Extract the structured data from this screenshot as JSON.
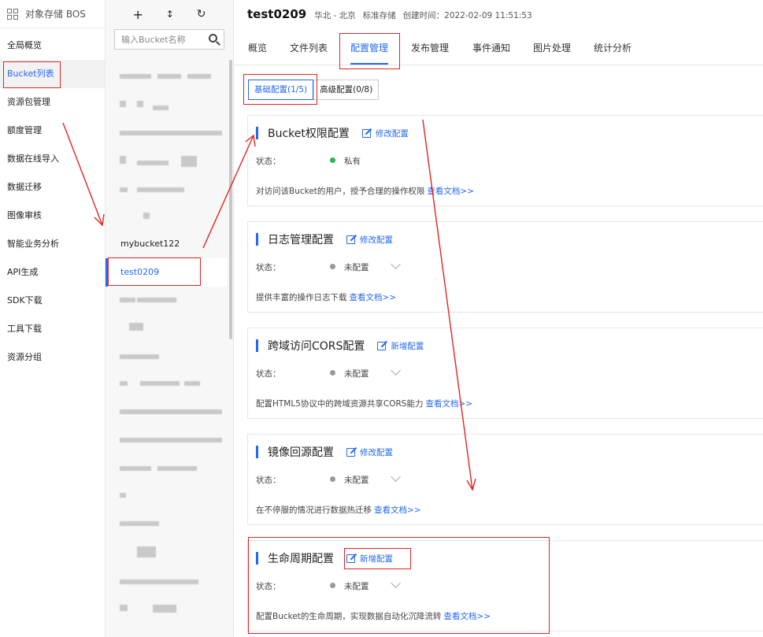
{
  "app": {
    "title": "对象存储 BOS"
  },
  "nav": {
    "items": [
      {
        "label": "全局概览"
      },
      {
        "label": "Bucket列表",
        "active": true
      },
      {
        "label": "资源包管理"
      },
      {
        "label": "额度管理"
      },
      {
        "label": "数据在线导入"
      },
      {
        "label": "数据迁移"
      },
      {
        "label": "图像审核"
      },
      {
        "label": "智能业务分析"
      },
      {
        "label": "API生成"
      },
      {
        "label": "SDK下载"
      },
      {
        "label": "工具下载"
      },
      {
        "label": "资源分组"
      }
    ]
  },
  "bucket_panel": {
    "tools": {
      "add": "+",
      "sort": "↕",
      "refresh": "↻"
    },
    "search": {
      "placeholder": "输入Bucket名称"
    },
    "visible_buckets": [
      {
        "name": "mybucket122"
      },
      {
        "name": "test0209",
        "selected": true
      }
    ]
  },
  "bucket_header": {
    "name": "test0209",
    "region": "华北 - 北京",
    "storage_class": "标准存储",
    "created": "创建时间：2022-02-09 11:51:53"
  },
  "tabs": [
    {
      "label": "概览"
    },
    {
      "label": "文件列表"
    },
    {
      "label": "配置管理",
      "active": true
    },
    {
      "label": "发布管理"
    },
    {
      "label": "事件通知"
    },
    {
      "label": "图片处理"
    },
    {
      "label": "统计分析"
    }
  ],
  "config_tabs": [
    {
      "label": "基础配置(1/5)",
      "active": true
    },
    {
      "label": "高级配置(0/8)"
    }
  ],
  "status_label": "状态：",
  "doc_link": "查看文档>>",
  "cards": [
    {
      "title": "Bucket权限配置",
      "action": "修改配置",
      "status": "私有",
      "enabled": true,
      "dropdown": false,
      "desc": "对访问该Bucket的用户，授予合理的操作权限"
    },
    {
      "title": "日志管理配置",
      "action": "修改配置",
      "status": "未配置",
      "enabled": false,
      "dropdown": true,
      "desc": "提供丰富的操作日志下载"
    },
    {
      "title": "跨域访问CORS配置",
      "action": "新增配置",
      "status": "未配置",
      "enabled": false,
      "dropdown": true,
      "desc": "配置HTML5协议中的跨域资源共享CORS能力"
    },
    {
      "title": "镜像回源配置",
      "action": "修改配置",
      "status": "未配置",
      "enabled": false,
      "dropdown": true,
      "desc": "在不停服的情况进行数据热迁移"
    },
    {
      "title": "生命周期配置",
      "action": "新增配置",
      "status": "未配置",
      "enabled": false,
      "dropdown": true,
      "desc": "配置Bucket的生命周期，实现数据自动化沉降流转"
    }
  ],
  "colors": {
    "accent": "#2468f2",
    "enabled": "#1db954",
    "annotation": "#e02424"
  }
}
